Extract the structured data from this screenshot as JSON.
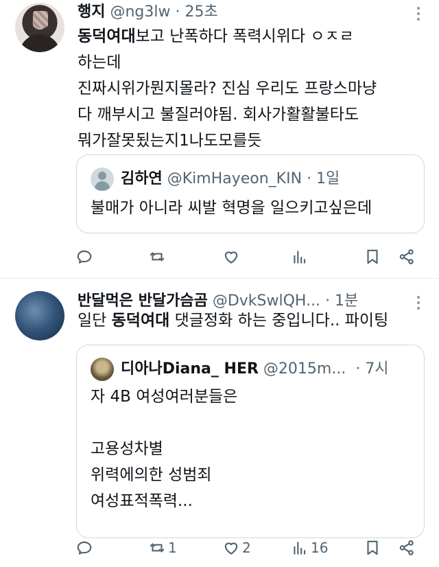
{
  "tweets": [
    {
      "author": {
        "name": "행지",
        "handle": "@ng3lw",
        "time": "· 25초"
      },
      "text": {
        "highlight": "동덕여대",
        "line1_rest": "보고 난폭하다 폭력시위다 ㅇㅈㄹ",
        "line2": "하는데",
        "line3": "진짜시위가뭔지몰라? 진심 우리도 프랑스마냥",
        "line4": "다 깨부시고 불질러야됨. 회사가활활불타도",
        "line5": "뭐가잘못됬는지1나도모를듯"
      },
      "quote": {
        "name": "김하연",
        "handle": "@KimHayeon_KIN",
        "time": "· 1일",
        "text": "불매가 아니라 씨발 혁명을 일으키고싶은데"
      },
      "actions": {
        "reply": "",
        "retweet": "",
        "like": "",
        "views": ""
      }
    },
    {
      "author": {
        "name": "반달먹은 반달가슴곰",
        "handle": "@DvkSwlQH...",
        "time": "· 1분"
      },
      "text": {
        "prefix": "일단 ",
        "highlight": "동덕여대",
        "suffix": " 댓글정화 하는 중입니다.. 파이팅"
      },
      "quote": {
        "name": "디아나Diana_ HER",
        "handle": "@2015m...",
        "time": "· 7시",
        "text": "자 4B 여성여러분들은\n\n고용성차별\n위력에의한 성범죄\n여성표적폭력..."
      },
      "actions": {
        "reply": "",
        "retweet": "1",
        "like": "2",
        "views": "16"
      }
    }
  ],
  "icons": [
    "more-icon",
    "reply-icon",
    "retweet-icon",
    "like-icon",
    "views-icon",
    "bookmark-icon",
    "share-icon"
  ],
  "colors": {
    "text": "#0f1419",
    "secondary": "#536471",
    "border": "#cfd9de",
    "divider": "#e6e9ec"
  }
}
